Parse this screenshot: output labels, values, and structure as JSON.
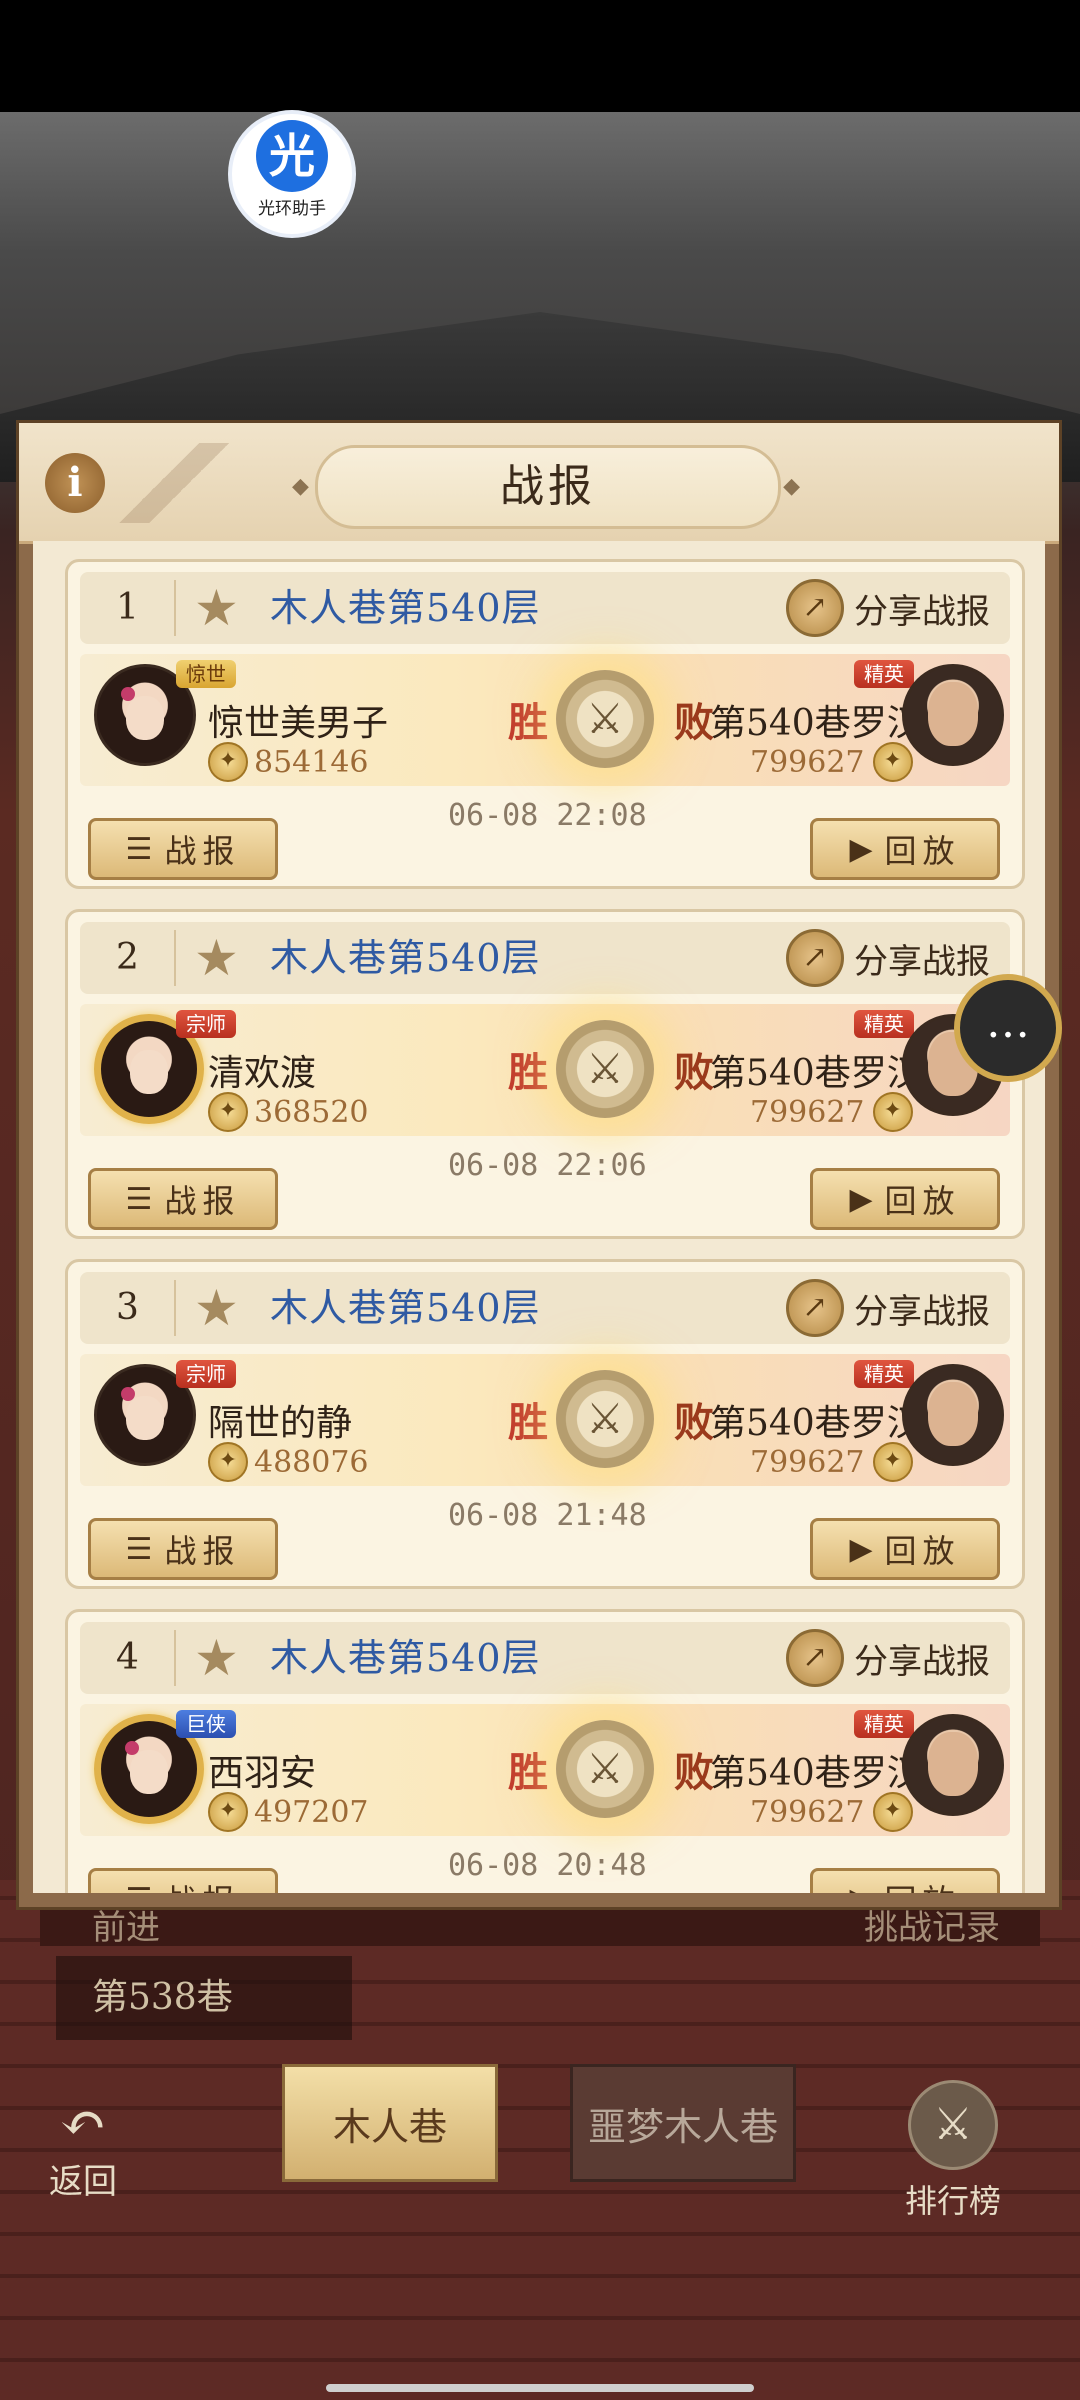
{
  "helper": {
    "glyph": "光",
    "label": "光环助手"
  },
  "dialog": {
    "title": "战报",
    "info_icon": "i"
  },
  "share_label": "分享战报",
  "report_label": "战报",
  "replay_label": "回放",
  "win_label": "胜",
  "lose_label": "败",
  "cards": [
    {
      "index": "1",
      "level": "木人巷第540层",
      "player": "惊世美男子",
      "player_rank": "惊世",
      "player_power": "854146",
      "opponent": "第540巷罗汉",
      "opponent_rank": "精英",
      "opponent_power": "799627",
      "time": "06-08 22:08"
    },
    {
      "index": "2",
      "level": "木人巷第540层",
      "player": "清欢渡",
      "player_rank": "宗师",
      "player_power": "368520",
      "opponent": "第540巷罗汉",
      "opponent_rank": "精英",
      "opponent_power": "799627",
      "time": "06-08 22:06"
    },
    {
      "index": "3",
      "level": "木人巷第540层",
      "player": "隔世的静",
      "player_rank": "宗师",
      "player_power": "488076",
      "opponent": "第540巷罗汉",
      "opponent_rank": "精英",
      "opponent_power": "799627",
      "time": "06-08 21:48"
    },
    {
      "index": "4",
      "level": "木人巷第540层",
      "player": "西羽安",
      "player_rank": "巨侠",
      "player_power": "497207",
      "opponent": "第540巷罗汉",
      "opponent_rank": "精英",
      "opponent_power": "799627",
      "time": "06-08 20:48"
    }
  ],
  "background": {
    "left_label": "前进",
    "right_label": "挑战记录",
    "current_level": "第538巷",
    "tab_active": "木人巷",
    "tab_inactive": "噩梦木人巷",
    "back_label": "返回",
    "rank_label": "排行榜"
  },
  "colors": {
    "accent_blue": "#2f5aa3",
    "win_red": "#c0392b",
    "gold": "#d2a94f"
  }
}
